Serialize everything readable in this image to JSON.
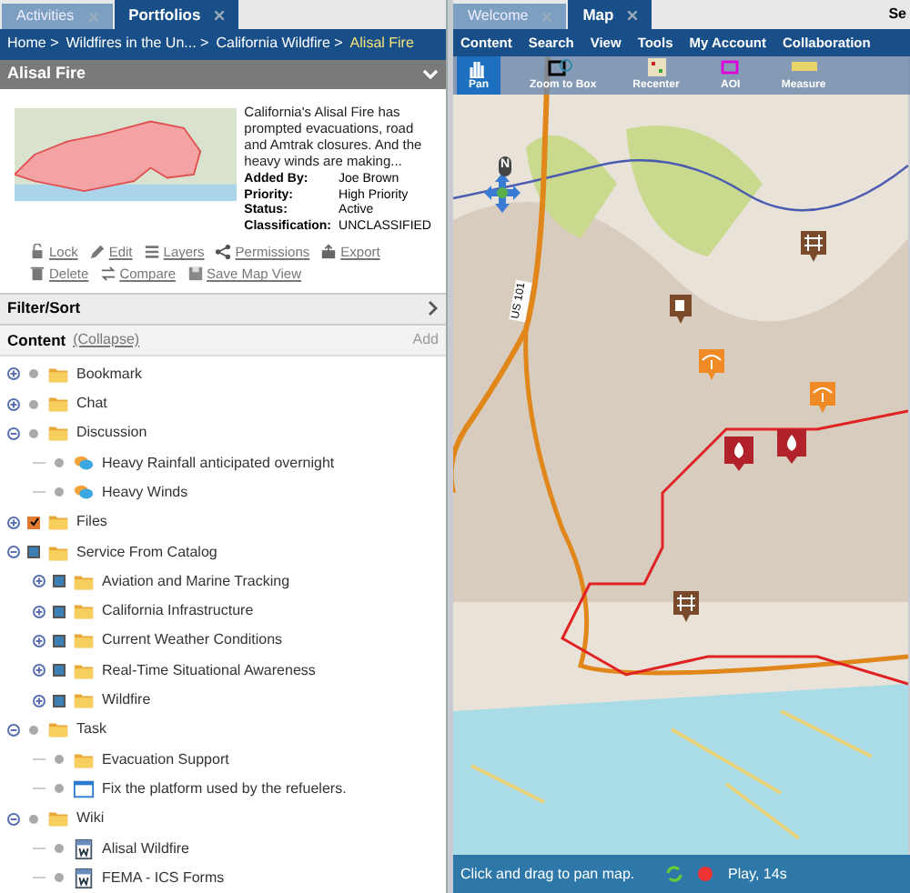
{
  "left_tabs": [
    {
      "label": "Activities",
      "selected": false
    },
    {
      "label": "Portfolios",
      "selected": true
    }
  ],
  "breadcrumb": [
    "Home >",
    "Wildfires in the Un... >",
    "California Wildfire >",
    "Alisal Fire"
  ],
  "item": {
    "title": "Alisal Fire",
    "description": "California's Alisal Fire has prompted evacuations, road and Amtrak closures. And the heavy winds are making...",
    "fields": [
      {
        "label": "Added By:",
        "value": "Joe Brown"
      },
      {
        "label": "Priority:",
        "value": "High Priority"
      },
      {
        "label": "Status:",
        "value": "Active"
      },
      {
        "label": "Classification:",
        "value": "UNCLASSIFIED"
      }
    ],
    "actions": [
      {
        "label": "Lock",
        "kind": "lock"
      },
      {
        "label": "Edit",
        "kind": "edit"
      },
      {
        "label": "Layers",
        "kind": "layers"
      },
      {
        "label": "Permissions",
        "kind": "share"
      },
      {
        "label": "Export",
        "kind": "export"
      },
      {
        "label": "Delete",
        "kind": "delete"
      },
      {
        "label": "Compare",
        "kind": "compare"
      },
      {
        "label": "Save Map View",
        "kind": "save"
      }
    ]
  },
  "filter_sort": {
    "label": "Filter/Sort"
  },
  "content": {
    "label": "Content",
    "collapse": "(Collapse)",
    "add": "Add"
  },
  "tree": [
    {
      "label": "Bookmark",
      "kind": "folder",
      "marker": {
        "kind": "dot"
      },
      "expanded": false
    },
    {
      "label": "Chat",
      "kind": "folder",
      "marker": {
        "kind": "dot"
      },
      "expanded": false
    },
    {
      "label": "Discussion",
      "kind": "folder",
      "marker": {
        "kind": "dot"
      },
      "expanded": true,
      "children": [
        {
          "label": "Heavy Rainfall anticipated overnight",
          "kind": "chat",
          "marker": {
            "kind": "dot"
          }
        },
        {
          "label": "Heavy Winds",
          "kind": "chat",
          "marker": {
            "kind": "dot"
          }
        }
      ]
    },
    {
      "label": "Files",
      "kind": "folder",
      "marker": {
        "kind": "checkbox"
      },
      "checked": true,
      "expanded": false
    },
    {
      "label": "Service From Catalog",
      "kind": "folder",
      "marker": {
        "kind": "layer"
      },
      "expanded": true,
      "children": [
        {
          "label": "Aviation and Marine Tracking",
          "kind": "folder",
          "marker": {
            "kind": "layer"
          },
          "expanded": false
        },
        {
          "label": "California Infrastructure",
          "kind": "folder",
          "marker": {
            "kind": "layer"
          },
          "expanded": false
        },
        {
          "label": "Current Weather Conditions",
          "kind": "folder",
          "marker": {
            "kind": "layer"
          },
          "expanded": false
        },
        {
          "label": "Real-Time Situational Awareness",
          "kind": "folder",
          "marker": {
            "kind": "layer"
          },
          "expanded": false
        },
        {
          "label": "Wildfire",
          "kind": "folder",
          "marker": {
            "kind": "layer"
          },
          "expanded": false
        }
      ]
    },
    {
      "label": "Task",
      "kind": "folder",
      "marker": {
        "kind": "dot"
      },
      "expanded": true,
      "children": [
        {
          "label": "Evacuation Support",
          "kind": "folder",
          "marker": {
            "kind": "dot"
          }
        },
        {
          "label": "Fix the platform used by the refuelers.",
          "kind": "task",
          "marker": {
            "kind": "dot"
          }
        }
      ]
    },
    {
      "label": "Wiki",
      "kind": "folder",
      "marker": {
        "kind": "dot"
      },
      "expanded": true,
      "children": [
        {
          "label": "Alisal Wildfire",
          "kind": "wiki",
          "marker": {
            "kind": "dot"
          }
        },
        {
          "label": "FEMA - ICS Forms",
          "kind": "wiki",
          "marker": {
            "kind": "dot"
          }
        }
      ]
    }
  ],
  "right_tabs": [
    {
      "label": "Welcome",
      "selected": false
    },
    {
      "label": "Map",
      "selected": true
    }
  ],
  "right_corner": "Se",
  "menu": [
    "Content",
    "Search",
    "View",
    "Tools",
    "My Account",
    "Collaboration"
  ],
  "toolbar": [
    {
      "label": "Pan",
      "kind": "pan",
      "selected": true
    },
    {
      "label": "Zoom to Box",
      "kind": "zoom",
      "selected": false
    },
    {
      "label": "Recenter",
      "kind": "recenter",
      "selected": false
    },
    {
      "label": "AOI",
      "kind": "aoi",
      "selected": false
    },
    {
      "label": "Measure",
      "kind": "measure",
      "selected": false
    }
  ],
  "map": {
    "compass": "N",
    "road_label": "US 101"
  },
  "status_bar": {
    "hint": "Click and drag to pan map.",
    "playback": "Play, 14s"
  }
}
